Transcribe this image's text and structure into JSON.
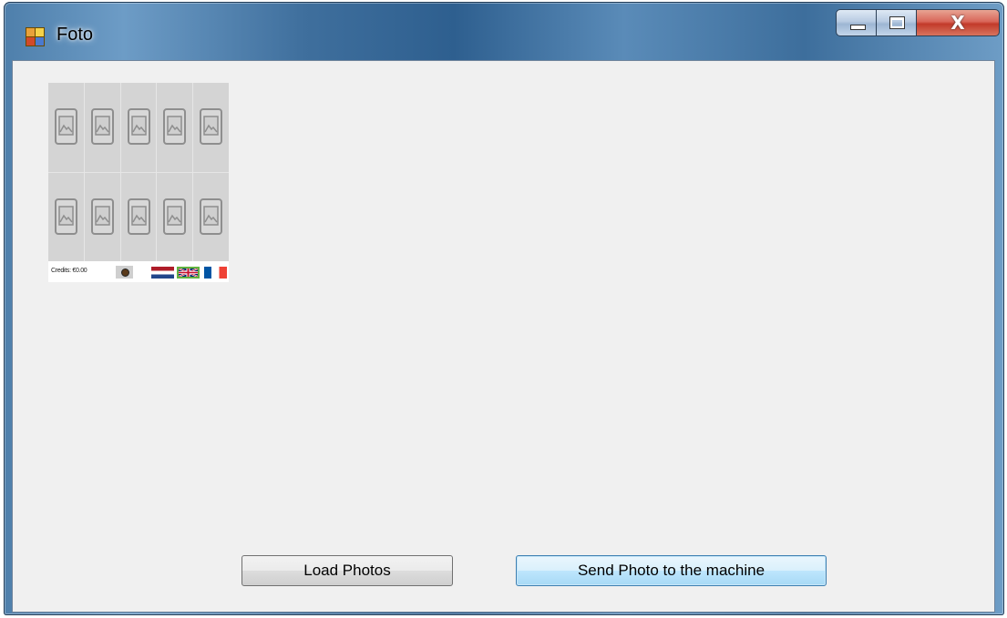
{
  "window": {
    "title": "Foto",
    "controls": {
      "minimize": "minimize-icon",
      "maximize": "maximize-icon",
      "close": "X"
    }
  },
  "photo_panel": {
    "slots": [
      {
        "icon": "image-placeholder-icon"
      },
      {
        "icon": "image-placeholder-icon"
      },
      {
        "icon": "image-placeholder-icon"
      },
      {
        "icon": "image-placeholder-icon"
      },
      {
        "icon": "image-placeholder-icon"
      },
      {
        "icon": "image-placeholder-icon"
      },
      {
        "icon": "image-placeholder-icon"
      },
      {
        "icon": "image-placeholder-icon"
      },
      {
        "icon": "image-placeholder-icon"
      },
      {
        "icon": "image-placeholder-icon"
      }
    ],
    "credits": "Credits: €0.00",
    "languages": [
      "nl",
      "en",
      "fr"
    ],
    "selected_language": "en"
  },
  "buttons": {
    "load": "Load Photos",
    "send": "Send Photo to the machine"
  },
  "colors": {
    "client_bg": "#f0f0f0",
    "slot_bg": "#d4d4d4",
    "send_accent": "#3c7fb1"
  }
}
